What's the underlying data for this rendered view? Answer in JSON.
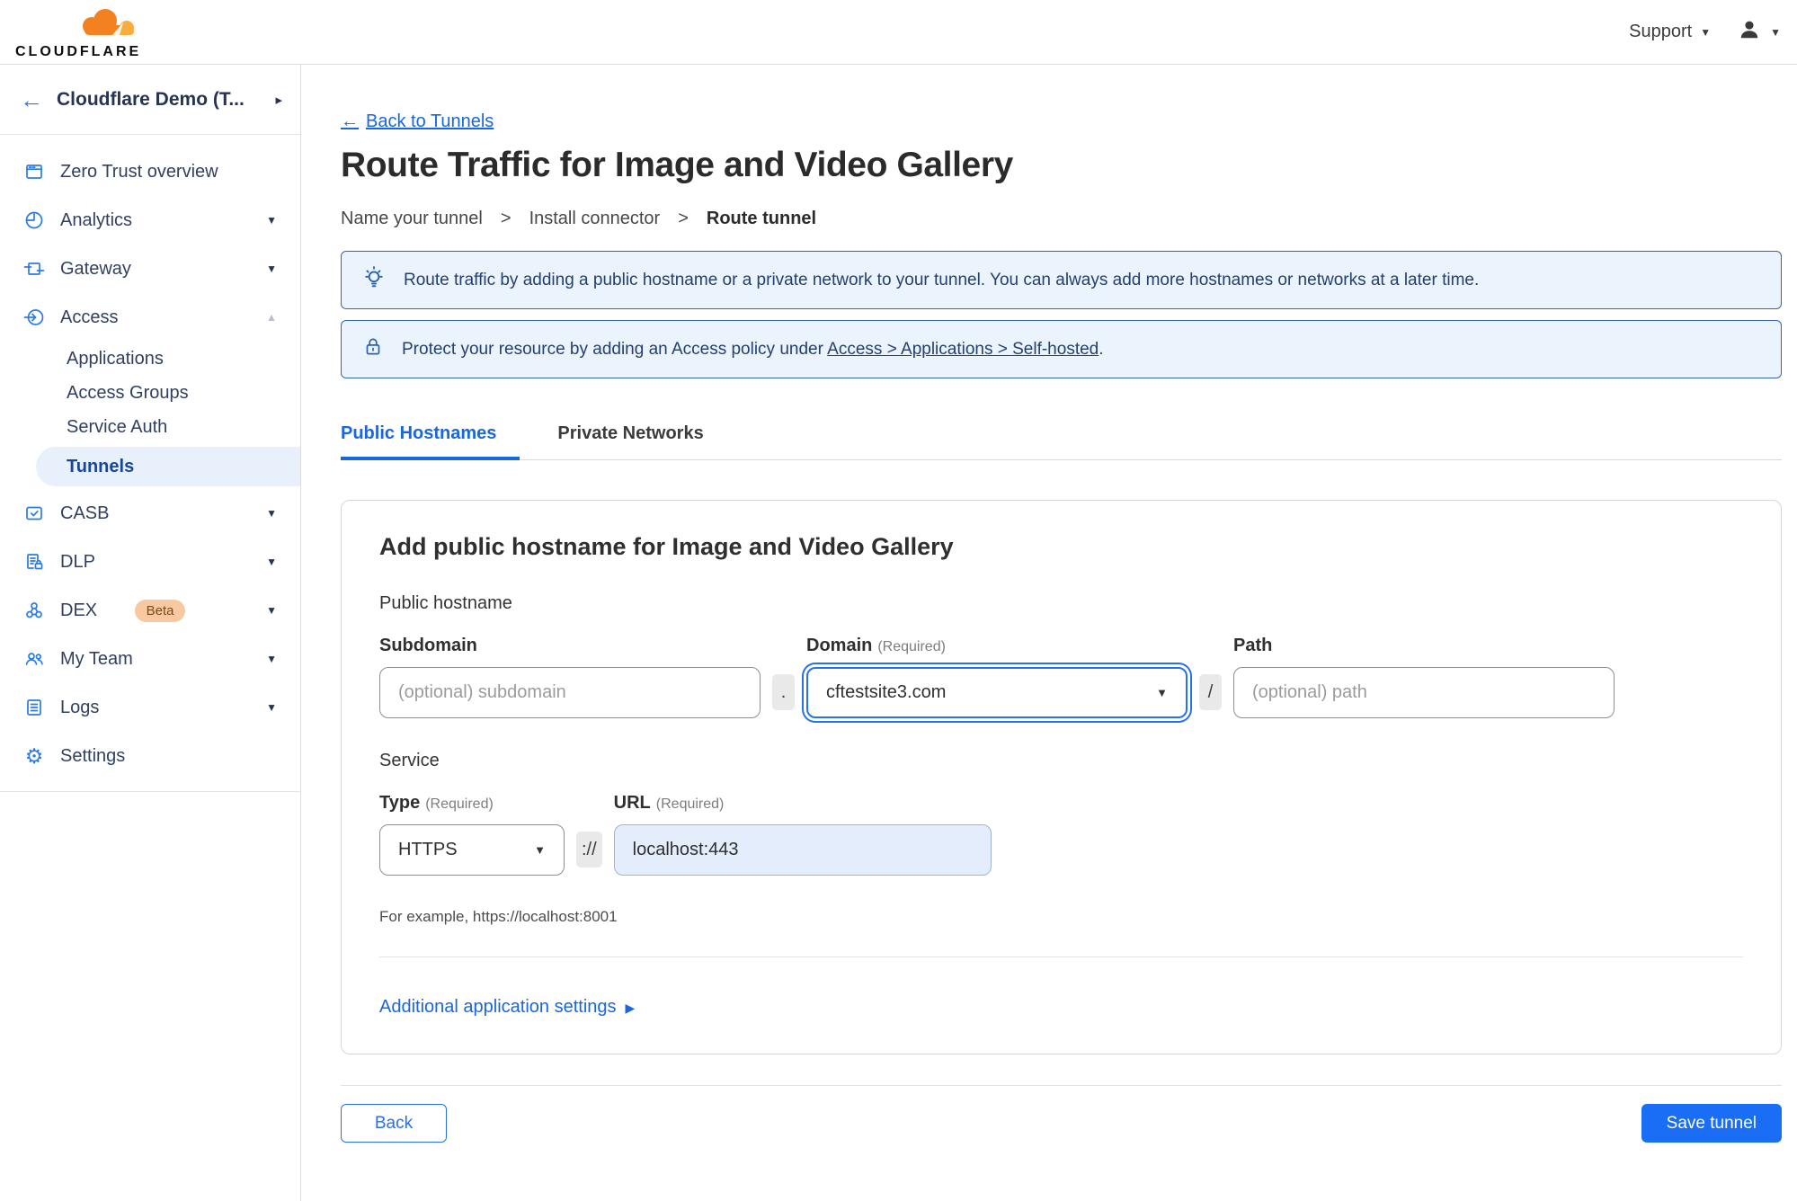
{
  "icons": {
    "back_arrow": "←",
    "chevron_right": "▸",
    "chevron_down": "▼",
    "chevron_up": "▲",
    "triangle_right": "▶",
    "gear": "⚙"
  },
  "header": {
    "brand": "CLOUDFLARE",
    "support_label": "Support"
  },
  "sidebar": {
    "account_label": "Cloudflare Demo (T...",
    "items": [
      {
        "label": "Zero Trust overview"
      },
      {
        "label": "Analytics"
      },
      {
        "label": "Gateway"
      },
      {
        "label": "Access"
      },
      {
        "label": "CASB"
      },
      {
        "label": "DLP"
      },
      {
        "label": "DEX",
        "badge": "Beta"
      },
      {
        "label": "My Team"
      },
      {
        "label": "Logs"
      },
      {
        "label": "Settings"
      }
    ],
    "access_children": [
      {
        "label": "Applications"
      },
      {
        "label": "Access Groups"
      },
      {
        "label": "Service Auth"
      },
      {
        "label": "Tunnels"
      }
    ]
  },
  "main": {
    "back_link_label": "Back to Tunnels",
    "title": "Route Traffic for Image and Video Gallery",
    "steps": {
      "separator": ">",
      "items": [
        "Name your tunnel",
        "Install connector",
        "Route tunnel"
      ]
    },
    "banners": {
      "tip": "Route traffic by adding a public hostname or a private network to your tunnel. You can always add more hostnames or networks at a later time.",
      "access_prefix": "Protect your resource by adding an Access policy under",
      "access_link": "Access > Applications > Self-hosted",
      "access_suffix": "."
    },
    "tabs": [
      {
        "label": "Public Hostnames"
      },
      {
        "label": "Private Networks"
      }
    ],
    "card": {
      "heading": "Add public hostname for Image and Video Gallery",
      "public_hostname_label": "Public hostname",
      "subdomain_label": "Subdomain",
      "subdomain_placeholder": "(optional) subdomain",
      "dot_separator": ".",
      "domain_label": "Domain",
      "required_label": "(Required)",
      "domain_value": "cftestsite3.com",
      "slash_separator": "/",
      "path_label": "Path",
      "path_placeholder": "(optional) path",
      "service_label": "Service",
      "type_label": "Type",
      "type_value": "HTTPS",
      "scheme_separator": "://",
      "url_label": "URL",
      "url_value": "localhost:443",
      "url_example": "For example, https://localhost:8001",
      "additional_settings_label": "Additional application settings"
    },
    "footer": {
      "back_label": "Back",
      "save_label": "Save tunnel"
    }
  }
}
